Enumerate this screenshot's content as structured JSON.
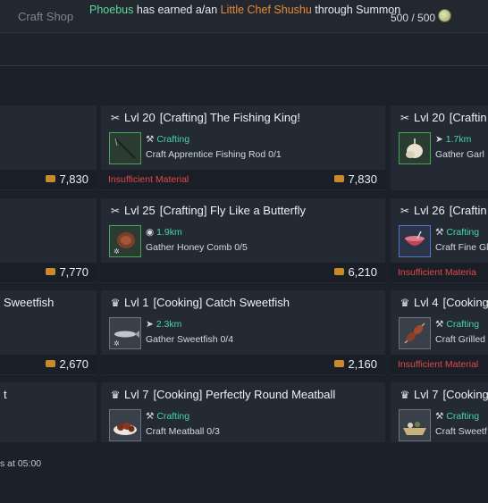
{
  "header": {
    "shop_title": "Craft Shop",
    "notice": {
      "player": "Phoebus",
      "middle": " has earned a/an ",
      "item": "Little Chef Shushu",
      "tail": " through Summon"
    },
    "counter": "500 / 500",
    "colors": {
      "player": "#5fd79c",
      "item": "#e68a3b"
    }
  },
  "cards": {
    "r1_left": {
      "price": "7,830"
    },
    "r1_mid": {
      "level": "Lvl 20",
      "title": "[Crafting] The Fishing King!",
      "line1": "Crafting",
      "line2": "Craft Apprentice Fishing Rod 0/1",
      "warning": "Insufficient Material",
      "price": "7,830",
      "icon": "crafting-icon"
    },
    "r1_right": {
      "level": "Lvl 20",
      "title": "[Craftin",
      "line1": "1.7km",
      "line2": "Gather Garl",
      "icon": "crafting-icon"
    },
    "r2_left": {
      "price": "7,770"
    },
    "r2_mid": {
      "level": "Lvl 25",
      "title": "[Crafting] Fly Like a Butterfly",
      "line1": "1.9km",
      "line2": "Gather Honey Comb 0/5",
      "price": "6,210",
      "icon": "crafting-icon"
    },
    "r2_right": {
      "level": "Lvl 26",
      "title": "[Craftin",
      "line1": "Crafting",
      "line2": "Craft Fine Gl",
      "warning": "Insufficient Materia",
      "icon": "crafting-icon"
    },
    "r3_left": {
      "title": "Sweetfish",
      "price": "2,670"
    },
    "r3_mid": {
      "level": "Lvl 1",
      "title": "[Cooking] Catch Sweetfish",
      "line1": "2.3km",
      "line2": "Gather Sweetfish 0/4",
      "price": "2,160",
      "icon": "chef-hat-icon"
    },
    "r3_right": {
      "level": "Lvl 4",
      "title": "[Cooking",
      "line1": "Crafting",
      "line2": "Craft Grilled",
      "warning": "Insufficient Material",
      "icon": "chef-hat-icon"
    },
    "r4_left": {
      "title": "t"
    },
    "r4_mid": {
      "level": "Lvl 7",
      "title": "[Cooking] Perfectly Round Meatball",
      "line1": "Crafting",
      "line2": "Craft Meatball 0/3",
      "icon": "chef-hat-icon"
    },
    "r4_right": {
      "level": "Lvl 7",
      "title": "[Cooking",
      "line1": "Crafting",
      "line2": "Craft Sweetf",
      "icon": "chef-hat-icon"
    }
  },
  "footer": {
    "reset_text": "s at 05:00"
  },
  "colors": {
    "warning": "#e0484c",
    "teal": "#48d1b0",
    "coin": "#c98b2a"
  }
}
